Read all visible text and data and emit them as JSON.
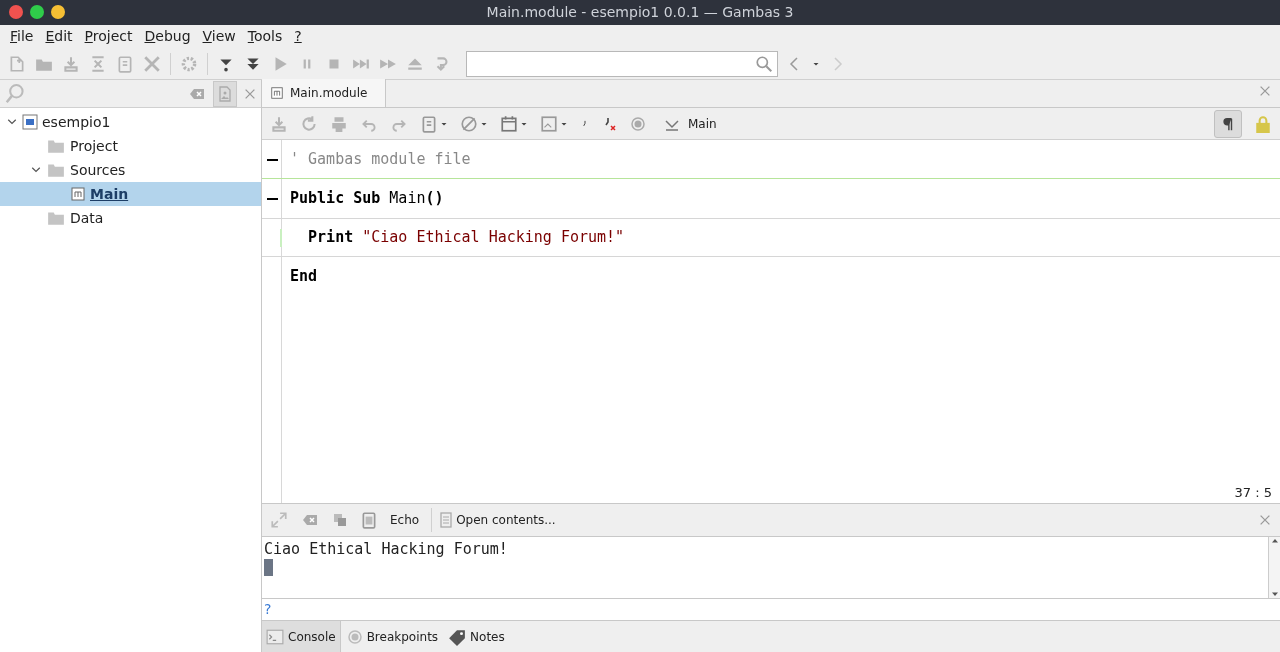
{
  "window": {
    "title": "Main.module - esempio1 0.0.1 — Gambas 3"
  },
  "menu": [
    "File",
    "Edit",
    "Project",
    "Debug",
    "View",
    "Tools",
    "?"
  ],
  "project_tree": [
    {
      "label": "esempio1",
      "kind": "project",
      "expanded": true,
      "selected": false,
      "children": [
        {
          "label": "Project",
          "kind": "folder",
          "selected": false
        },
        {
          "label": "Sources",
          "kind": "folder",
          "expanded": true,
          "selected": false,
          "children": [
            {
              "label": "Main",
              "kind": "module",
              "selected": true
            }
          ]
        },
        {
          "label": "Data",
          "kind": "folder",
          "selected": false
        }
      ]
    }
  ],
  "editor_tabs": [
    {
      "label": "Main.module",
      "selected": true
    }
  ],
  "editor_toolbar": {
    "procedure": "Main"
  },
  "code": [
    {
      "fold": true,
      "current": false,
      "separator_after": true,
      "segments": [
        {
          "text": "' Gambas module file",
          "kind": "comment"
        }
      ]
    },
    {
      "fold": true,
      "current": false,
      "separator_after": false,
      "segments": [
        {
          "text": "Public Sub ",
          "kind": "keyword"
        },
        {
          "text": "Main",
          "kind": "plain"
        },
        {
          "text": "()",
          "kind": "keyword"
        }
      ]
    },
    {
      "fold": false,
      "current": true,
      "separator_after": false,
      "segments": [
        {
          "text": "  Print ",
          "kind": "keyword"
        },
        {
          "text": "\"Ciao Ethical Hacking Forum!\"",
          "kind": "string"
        }
      ]
    },
    {
      "fold": false,
      "current": false,
      "separator_after": false,
      "segments": [
        {
          "text": "End",
          "kind": "keyword"
        }
      ]
    }
  ],
  "cursor_position": "37 : 5",
  "console_toolbar": {
    "echo": "Echo",
    "open": "Open contents..."
  },
  "console_output": "Ciao Ethical Hacking Forum!",
  "console_prompt": "?",
  "bottom_tabs": [
    {
      "label": "Console",
      "kind": "console",
      "selected": true
    },
    {
      "label": "Breakpoints",
      "kind": "breakpoints",
      "selected": false
    },
    {
      "label": "Notes",
      "kind": "notes",
      "selected": false
    }
  ]
}
